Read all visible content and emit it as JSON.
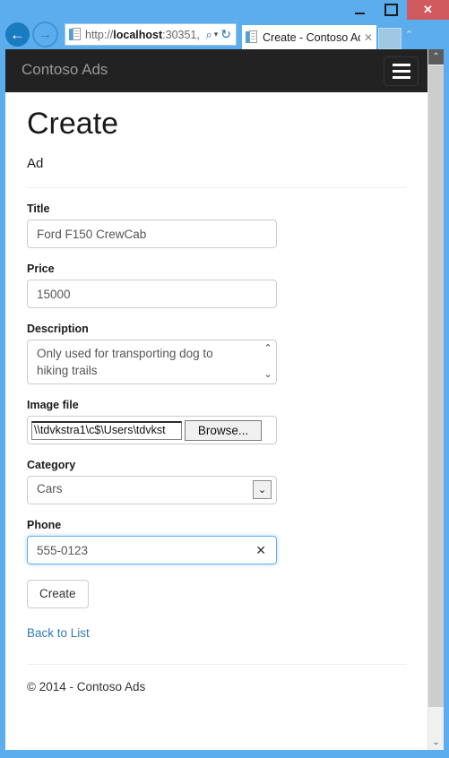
{
  "window": {
    "minimize_label": "—",
    "maximize_label": "□",
    "close_label": "✕"
  },
  "browser": {
    "back_label": "←",
    "forward_label": "→",
    "address": {
      "scheme": "http://",
      "host": "localhost",
      "rest": ":30351,",
      "search_icon": "search-icon",
      "caret_icon": "chevron-down-icon",
      "refresh_icon": "refresh-icon",
      "refresh_label": "↻",
      "search_label": "⌕",
      "caret_label": "▾"
    },
    "tab": {
      "title": "Create - Contoso Ads",
      "close_label": "✕"
    }
  },
  "navbar": {
    "brand": "Contoso Ads",
    "menu_toggle_name": "hamburger-menu-icon"
  },
  "page": {
    "title": "Create",
    "subtitle": "Ad"
  },
  "form": {
    "title_field": {
      "label": "Title",
      "value": "Ford F150 CrewCab"
    },
    "price_field": {
      "label": "Price",
      "value": "15000"
    },
    "description_field": {
      "label": "Description",
      "value": "Only used for transporting dog to hiking trails",
      "scroll_up": "⌃",
      "scroll_down": "⌄"
    },
    "image_file_field": {
      "label": "Image file",
      "value": "\\\\tdvkstra1\\c$\\Users\\tdvkst",
      "browse_label": "Browse..."
    },
    "category_field": {
      "label": "Category",
      "value": "Cars",
      "arrow_label": "⌄",
      "options": [
        "Cars"
      ]
    },
    "phone_field": {
      "label": "Phone",
      "value": "555-0123",
      "clear_label": "✕"
    },
    "submit_label": "Create",
    "back_link_label": "Back to List"
  },
  "footer": {
    "text": "© 2014 - Contoso Ads"
  },
  "scrollbar": {
    "up_label": "⌃",
    "down_label": "⌄"
  },
  "colors": {
    "chrome_blue": "#5CADEE",
    "navbar_dark": "#222222",
    "link_blue": "#337AB7",
    "focus_blue": "#66AFE9",
    "close_red": "#D05A5E"
  }
}
